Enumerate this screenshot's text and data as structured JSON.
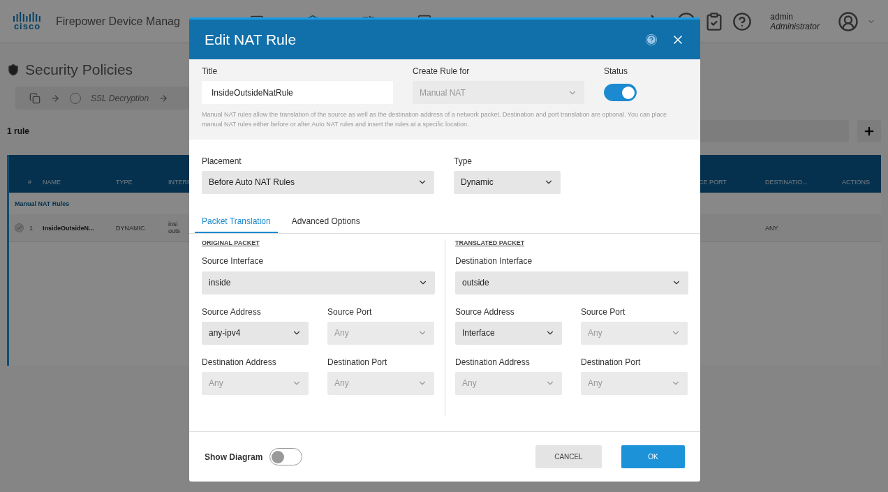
{
  "header": {
    "logo_text": "cisco",
    "app_name": "Firepower Device Manag",
    "user": {
      "name": "admin",
      "role": "Administrator"
    }
  },
  "page": {
    "title": "Security Policies",
    "breadcrumb": [
      "SSL Decryption"
    ],
    "rule_count": "1 rule",
    "table": {
      "columns_left": [
        "#",
        "NAME",
        "TYPE",
        "INTERF"
      ],
      "columns_right": [
        "CE PORT",
        "DESTINATIO...",
        "ACTIONS"
      ],
      "group": "Manual NAT Rules",
      "row": {
        "checked": true,
        "number": "1",
        "name": "InsideOutsideN...",
        "type": "DYNAMIC",
        "interfaces": [
          "insi",
          "outs"
        ],
        "destination": "ANY"
      }
    }
  },
  "dialog": {
    "title": "Edit NAT Rule",
    "title_field": {
      "label": "Title",
      "value": "InsideOutsideNatRule"
    },
    "create_rule_for": {
      "label": "Create Rule for",
      "value": "Manual NAT",
      "disabled": true
    },
    "status": {
      "label": "Status",
      "on": true
    },
    "description": "Manual NAT rules allow the translation of the source as well as the destination address of a network packet. Destination and port translation are optional. You can place manual NAT rules either before or after Auto NAT rules and insert the rules at a specific location.",
    "placement": {
      "label": "Placement",
      "value": "Before Auto NAT Rules"
    },
    "type": {
      "label": "Type",
      "value": "Dynamic"
    },
    "tabs": [
      {
        "label": "Packet Translation",
        "selected": true
      },
      {
        "label": "Advanced Options",
        "selected": false
      }
    ],
    "packets": [
      {
        "heading": "ORIGINAL PACKET",
        "interface": {
          "label": "Source Interface",
          "value": "inside"
        },
        "fields": [
          {
            "label": "Source Address",
            "value": "any-ipv4",
            "disabled": false
          },
          {
            "label": "Source Port",
            "value": "Any",
            "disabled": true
          },
          {
            "label": "Destination Address",
            "value": "Any",
            "disabled": true
          },
          {
            "label": "Destination Port",
            "value": "Any",
            "disabled": true
          }
        ]
      },
      {
        "heading": "TRANSLATED PACKET",
        "interface": {
          "label": "Destination Interface",
          "value": "outside"
        },
        "fields": [
          {
            "label": "Source Address",
            "value": "Interface",
            "disabled": false
          },
          {
            "label": "Source Port",
            "value": "Any",
            "disabled": true
          },
          {
            "label": "Destination Address",
            "value": "Any",
            "disabled": true
          },
          {
            "label": "Destination Port",
            "value": "Any",
            "disabled": true
          }
        ]
      }
    ],
    "show_diagram": {
      "label": "Show Diagram",
      "on": false
    },
    "buttons": [
      {
        "label": "CANCEL",
        "kind": "secondary"
      },
      {
        "label": "OK",
        "kind": "primary"
      }
    ]
  }
}
